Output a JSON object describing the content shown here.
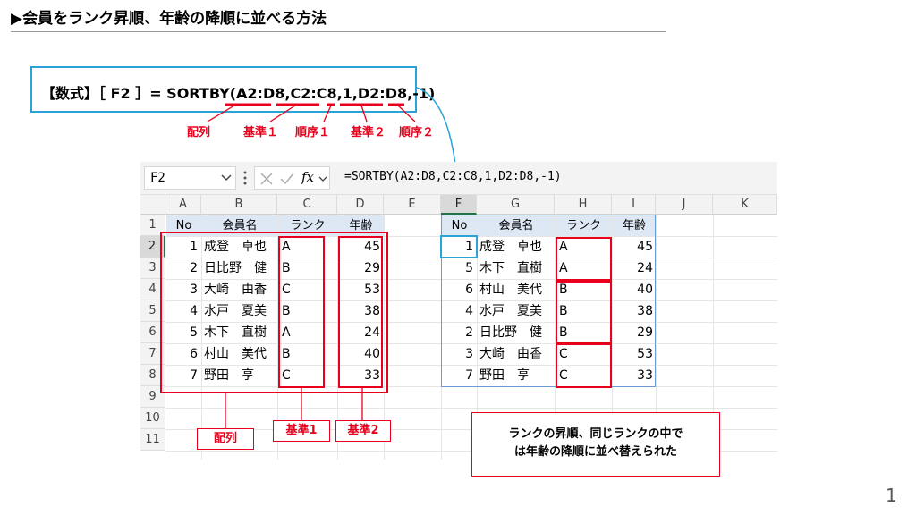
{
  "slide": {
    "title": "▶会員をランク昇順、年齢の降順に並べる方法",
    "formula_text": "【数式】［ F2 ］= SORTBY(A2:D8,C2:C8,1,D2:D8,-1)",
    "callouts": {
      "array": "配列",
      "key1": "基準１",
      "order1": "順序１",
      "key2": "基準２",
      "order2": "順序２"
    },
    "tags": {
      "array": "配列",
      "key1": "基準1",
      "key2": "基準2"
    },
    "annotation_line1": "ランクの昇順、同じランクの中で",
    "annotation_line2": "は年齢の降順に並べ替えられた",
    "page_number": "1"
  },
  "colors": {
    "accent_red": "#e8001c",
    "accent_blue": "#2aa3d6",
    "excel_green": "#217346",
    "header_fill": "#dde8f4"
  },
  "excel": {
    "name_box": "F2",
    "formula": "=SORTBY(A2:D8,C2:C8,1,D2:D8,-1)",
    "icons": {
      "name_dropdown": "chevron-down-icon",
      "menu": "vertical-dots-icon",
      "cancel": "close-icon",
      "enter": "check-icon",
      "function": "fx-icon"
    },
    "fx_label": "fx",
    "columns": [
      "A",
      "B",
      "C",
      "D",
      "E",
      "F",
      "G",
      "H",
      "I",
      "J",
      "K"
    ],
    "rows": [
      "1",
      "2",
      "3",
      "4",
      "5",
      "6",
      "7",
      "8",
      "9",
      "10",
      "11"
    ],
    "source_header": [
      "No",
      "会員名",
      "ランク",
      "年齢"
    ],
    "source_rows": [
      [
        "1",
        "成登　卓也",
        "A",
        "45"
      ],
      [
        "2",
        "日比野　健",
        "B",
        "29"
      ],
      [
        "3",
        "大崎　由香",
        "C",
        "53"
      ],
      [
        "4",
        "水戸　夏美",
        "B",
        "38"
      ],
      [
        "5",
        "木下　直樹",
        "A",
        "24"
      ],
      [
        "6",
        "村山　美代",
        "B",
        "40"
      ],
      [
        "7",
        "野田　亨",
        "C",
        "33"
      ]
    ],
    "result_header": [
      "No",
      "会員名",
      "ランク",
      "年齢"
    ],
    "result_rows": [
      [
        "1",
        "成登　卓也",
        "A",
        "45"
      ],
      [
        "5",
        "木下　直樹",
        "A",
        "24"
      ],
      [
        "6",
        "村山　美代",
        "B",
        "40"
      ],
      [
        "4",
        "水戸　夏美",
        "B",
        "38"
      ],
      [
        "2",
        "日比野　健",
        "B",
        "29"
      ],
      [
        "3",
        "大崎　由香",
        "C",
        "53"
      ],
      [
        "7",
        "野田　亨",
        "C",
        "33"
      ]
    ]
  }
}
